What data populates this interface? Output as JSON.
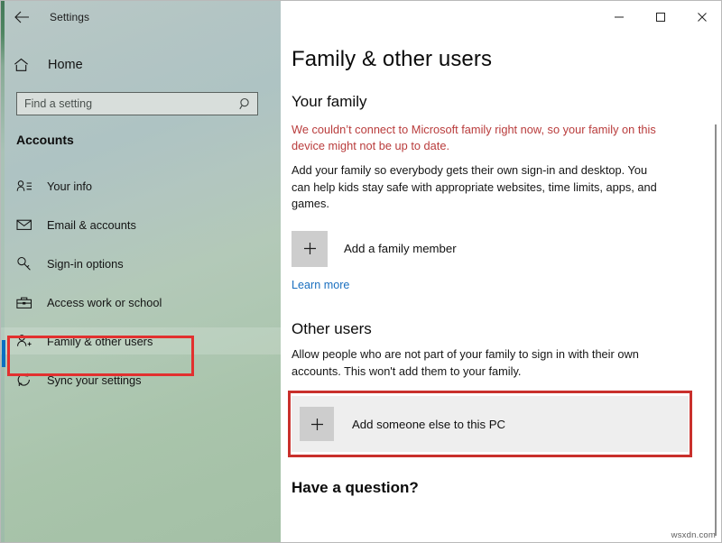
{
  "window": {
    "app_title": "Settings",
    "back_icon": "back-arrow-icon",
    "controls": {
      "minimize": "—",
      "maximize": "☐",
      "close": "✕"
    }
  },
  "sidebar": {
    "home_label": "Home",
    "home_icon": "home-icon",
    "search": {
      "placeholder": "Find a setting",
      "value": "",
      "icon": "search-icon"
    },
    "category": "Accounts",
    "selected_index": 4,
    "items": [
      {
        "label": "Your info",
        "icon": "person-info-icon"
      },
      {
        "label": "Email & accounts",
        "icon": "envelope-icon"
      },
      {
        "label": "Sign-in options",
        "icon": "key-icon"
      },
      {
        "label": "Access work or school",
        "icon": "briefcase-icon"
      },
      {
        "label": "Family & other users",
        "icon": "person-add-icon"
      },
      {
        "label": "Sync your settings",
        "icon": "sync-icon"
      }
    ]
  },
  "main": {
    "page_title": "Family & other users",
    "your_family": {
      "heading": "Your family",
      "error": "We couldn’t connect to Microsoft family right now, so your family on this device might not be up to date.",
      "description": "Add your family so everybody gets their own sign-in and desktop. You can help kids stay safe with appropriate websites, time limits, apps, and games.",
      "add_label": "Add a family member",
      "add_icon": "plus-icon",
      "learn_more": "Learn more"
    },
    "other_users": {
      "heading": "Other users",
      "description": "Allow people who are not part of your family to sign in with their own accounts. This won't add them to your family.",
      "add_label": "Add someone else to this PC",
      "add_icon": "plus-icon"
    },
    "question_heading": "Have a question?"
  },
  "watermark": "wsxdn.com",
  "colors": {
    "accent_blue": "#0a6fc2",
    "highlight_red": "#c9302c",
    "error_red": "#b93c3c",
    "link_blue": "#1a6fbf",
    "tile_grey": "#cdcdcd",
    "row_grey": "#eeeeee"
  }
}
